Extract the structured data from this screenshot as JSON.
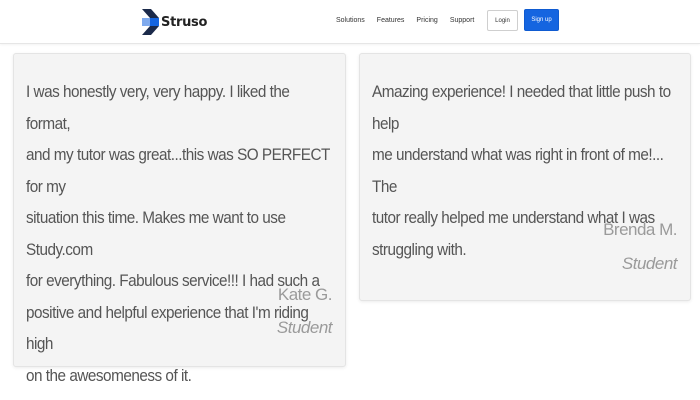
{
  "header": {
    "brand": "Struso",
    "logo_icon": "struso-s-logo",
    "nav": [
      "Solutions",
      "Features",
      "Pricing",
      "Support"
    ],
    "login_label": "Login",
    "signup_label": "Sign up",
    "colors": {
      "logo_blue": "#1565e0",
      "logo_dark": "#1b2a4a",
      "signup_bg": "#1565e0"
    }
  },
  "testimonials": [
    {
      "lines": [
        "I was honestly very, very happy. I liked the format,",
        "and my tutor was great...this was SO PERFECT for my",
        "situation this time. Makes me want to use Study.com",
        "for everything. Fabulous service!!! I had such a",
        "positive and helpful experience that I'm riding high",
        "on the awesomeness of it."
      ],
      "author": "Kate G.",
      "role": "Student"
    },
    {
      "lines": [
        "Amazing experience! I needed that little push to help",
        "me understand what was right in front of me!... The",
        "tutor really helped me understand what I was",
        "struggling with."
      ],
      "author": "Brenda M.",
      "role": "Student"
    }
  ]
}
